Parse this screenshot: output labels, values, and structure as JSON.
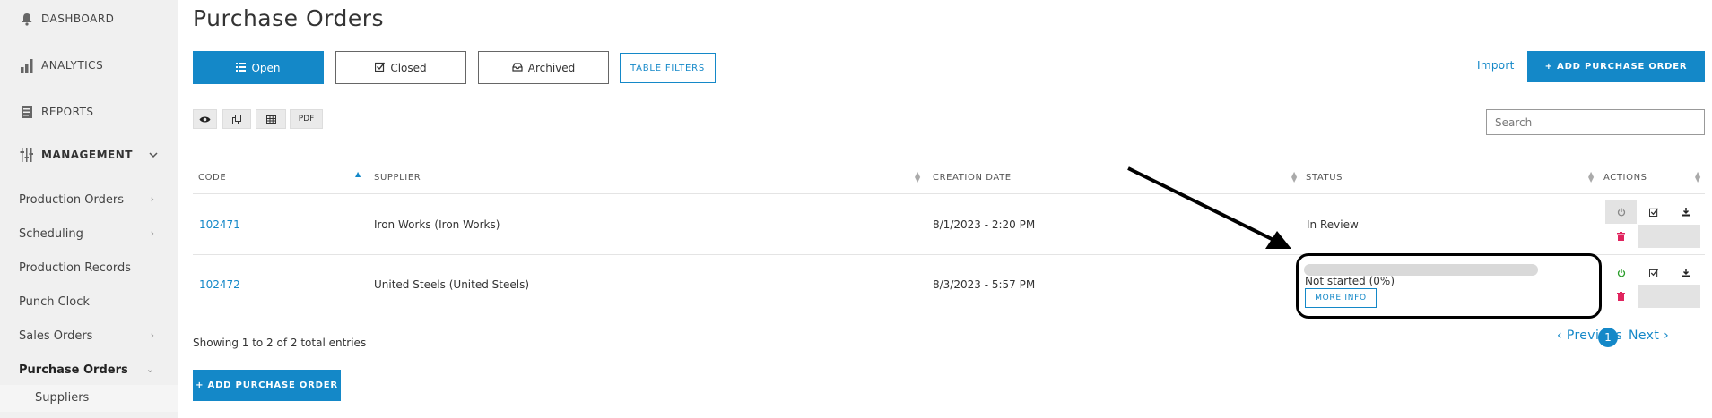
{
  "sidebar": {
    "top_items": [
      {
        "label": "DASHBOARD",
        "icon": "bell-icon"
      },
      {
        "label": "ANALYTICS",
        "icon": "bar-chart-icon"
      },
      {
        "label": "REPORTS",
        "icon": "document-icon"
      }
    ],
    "management": {
      "label": "MANAGEMENT",
      "icon": "sliders-icon",
      "expanded": true
    },
    "links": [
      {
        "label": "Production Orders",
        "has_arrow": true
      },
      {
        "label": "Scheduling",
        "has_arrow": true
      },
      {
        "label": "Production Records",
        "has_arrow": false
      },
      {
        "label": "Punch Clock",
        "has_arrow": false
      },
      {
        "label": "Sales Orders",
        "has_arrow": true
      },
      {
        "label": "Purchase Orders",
        "has_arrow": true,
        "active": true
      }
    ],
    "sub_items": [
      {
        "label": "Suppliers"
      }
    ]
  },
  "page": {
    "title": "Purchase Orders"
  },
  "tabs": [
    {
      "label": "Open",
      "icon": "list-icon",
      "active": true
    },
    {
      "label": "Closed",
      "icon": "check-square-icon",
      "active": false
    },
    {
      "label": "Archived",
      "icon": "inbox-icon",
      "active": false
    }
  ],
  "toolbar": {
    "table_filters": "TABLE FILTERS",
    "import": "Import",
    "add_purchase_order": "+ ADD PURCHASE ORDER",
    "tools": [
      {
        "icon": "eye-icon",
        "label": ""
      },
      {
        "icon": "copy-icon",
        "label": ""
      },
      {
        "icon": "table-icon",
        "label": ""
      },
      {
        "icon": "",
        "label": "PDF"
      }
    ],
    "search_placeholder": "Search"
  },
  "table": {
    "columns": [
      "CODE",
      "SUPPLIER",
      "CREATION DATE",
      "STATUS",
      "ACTIONS"
    ],
    "sorted_column": "CODE",
    "rows": [
      {
        "code": "102471",
        "supplier": "Iron Works (Iron Works)",
        "creation_date": "8/1/2023 - 2:20 PM",
        "status": "In Review",
        "progress": null,
        "power_icon_color": "#888888"
      },
      {
        "code": "102472",
        "supplier": "United Steels (United Steels)",
        "creation_date": "8/3/2023 - 5:57 PM",
        "status": "Not started (0%)",
        "progress": 0,
        "more_info": "MORE INFO",
        "power_icon_color": "#2a9d2a"
      }
    ]
  },
  "footer": {
    "showing": "Showing 1 to 2 of 2 total entries",
    "previous": "‹ Previous",
    "current_page": "1",
    "next": "Next ›",
    "add_purchase_order": "+ ADD PURCHASE ORDER"
  },
  "colors": {
    "accent": "#1488c8",
    "delete": "#e0245e",
    "power_active": "#2a9d2a"
  }
}
